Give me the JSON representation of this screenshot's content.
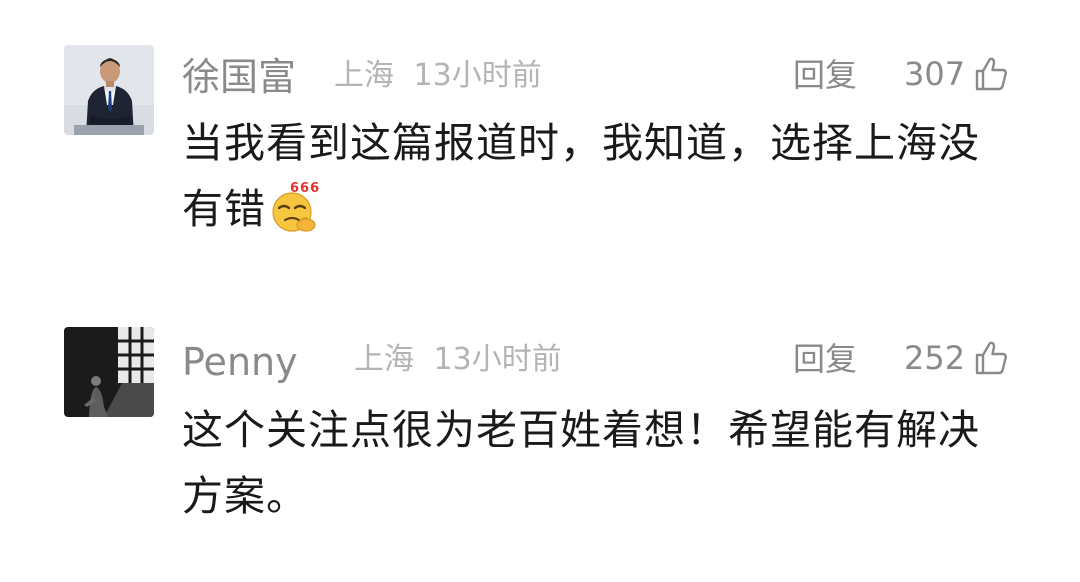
{
  "comments": [
    {
      "author": "徐国富",
      "location": "上海",
      "time": "13小时前",
      "reply_label": "回复",
      "likes": "307",
      "text": "当我看到这篇报道时，我知道，选择上海没有错",
      "emoji": "666-thinking-emoji",
      "emoji_text": "666",
      "avatar": "man-in-suit-avatar"
    },
    {
      "author": "Penny",
      "location": "上海",
      "time": "13小时前",
      "reply_label": "回复",
      "likes": "252",
      "text": "这个关注点很为老百姓着想！希望能有解决方案。",
      "avatar": "figure-by-window-avatar"
    }
  ],
  "colors": {
    "name": "#8a8a8a",
    "meta": "#b4b4b4",
    "body_text": "#1a1a1a",
    "background": "#ffffff"
  },
  "icons": {
    "like": "thumbs-up-icon"
  }
}
